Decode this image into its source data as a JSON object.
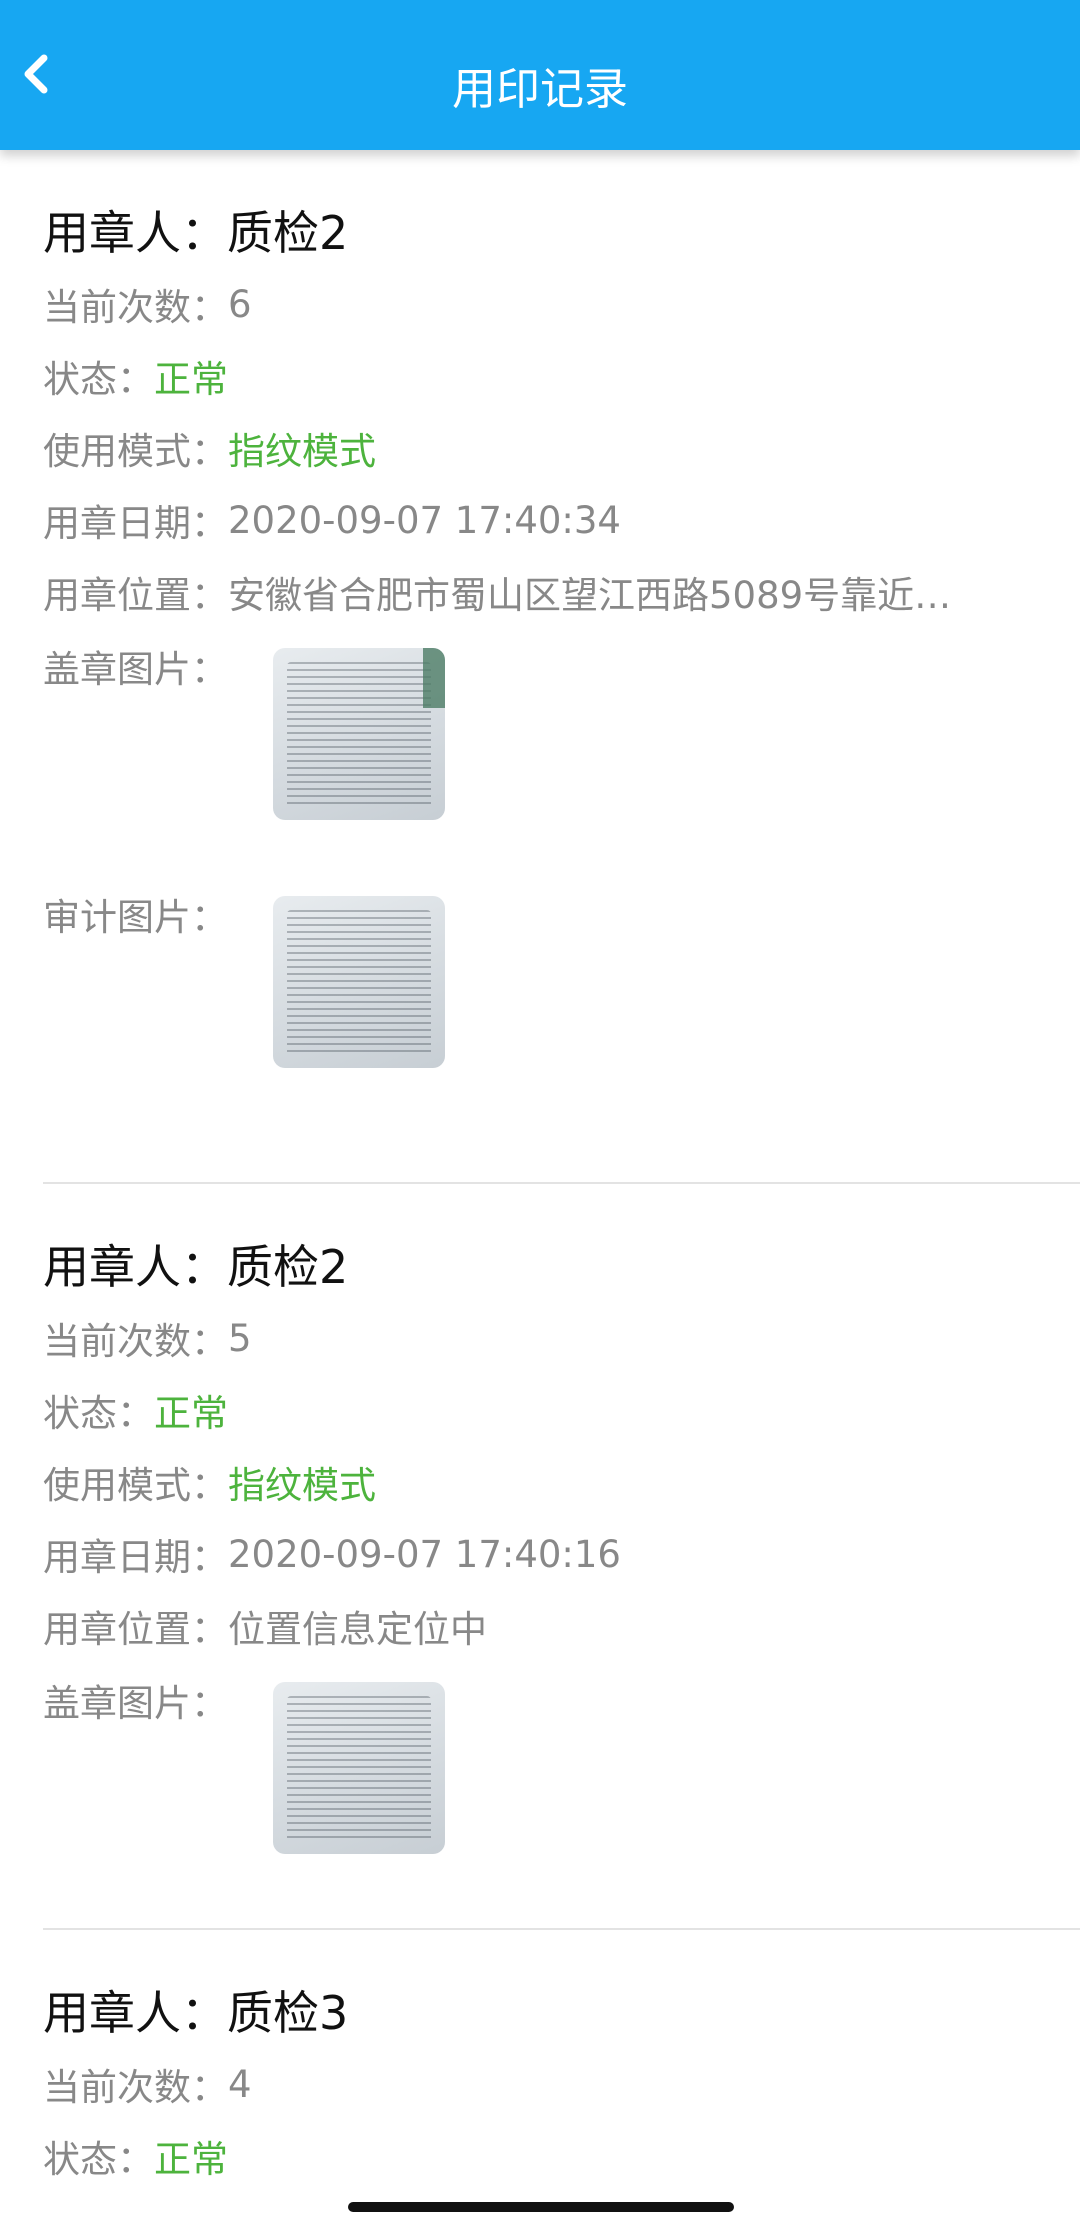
{
  "header": {
    "title": "用印记录",
    "back_icon": "chevron-left-icon"
  },
  "labels": {
    "user": "用章人：",
    "count": "当前次数：",
    "status": "状态：",
    "mode": "使用模式：",
    "date": "用章日期：",
    "location": "用章位置：",
    "stamp_image": "盖章图片：",
    "audit_image": "审计图片："
  },
  "records": [
    {
      "user": "质检2",
      "count": "6",
      "status": "正常",
      "mode": "指纹模式",
      "date": "2020-09-07 17:40:34",
      "location": "安徽省合肥市蜀山区望江西路5089号靠近…"
    },
    {
      "user": "质检2",
      "count": "5",
      "status": "正常",
      "mode": "指纹模式",
      "date": "2020-09-07 17:40:16",
      "location": "位置信息定位中"
    },
    {
      "user": "质检3",
      "count": "4",
      "status": "正常"
    }
  ],
  "colors": {
    "header_bg": "#17a7f2",
    "status_green": "#4db33d",
    "label_gray": "#888888"
  }
}
